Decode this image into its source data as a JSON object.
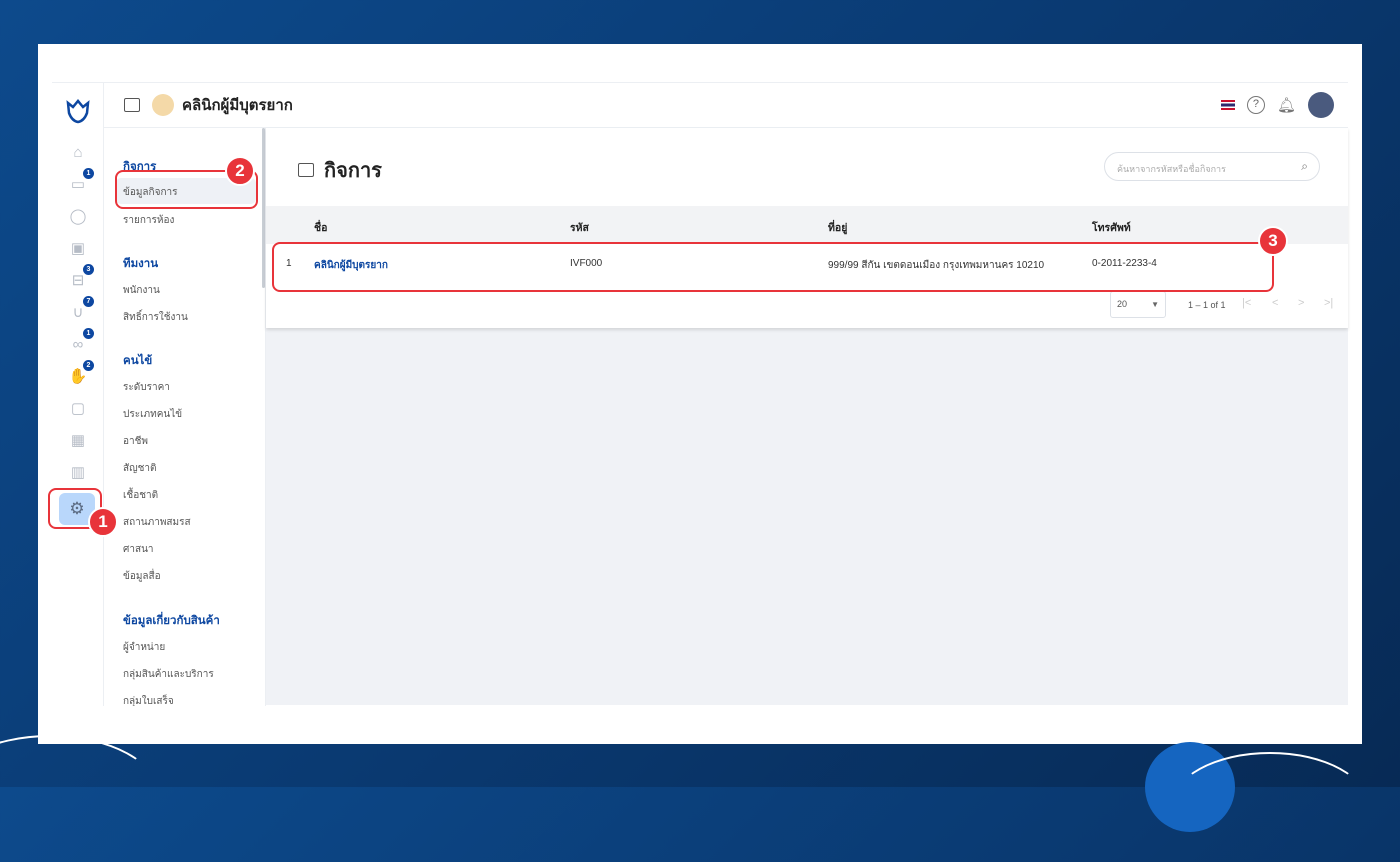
{
  "header": {
    "clinic_name": "คลินิกผู้มีบุตรยาก"
  },
  "rail": {
    "badges": {
      "appointments": "1",
      "treatment": "3",
      "doctor": "7",
      "lab": "1",
      "payment": "2"
    }
  },
  "menu": {
    "sections": [
      {
        "title": "กิจการ",
        "items": [
          "ข้อมูลกิจการ",
          "รายการห้อง"
        ]
      },
      {
        "title": "ทีมงาน",
        "items": [
          "พนักงาน",
          "สิทธิ์การใช้งาน"
        ]
      },
      {
        "title": "คนไข้",
        "items": [
          "ระดับราคา",
          "ประเภทคนไข้",
          "อาชีพ",
          "สัญชาติ",
          "เชื้อชาติ",
          "สถานภาพสมรส",
          "ศาสนา",
          "ข้อมูลสื่อ"
        ]
      },
      {
        "title": "ข้อมูลเกี่ยวกับสินค้า",
        "items": [
          "ผู้จำหน่าย",
          "กลุ่มสินค้าและบริการ",
          "กลุ่มใบเสร็จ"
        ]
      }
    ]
  },
  "page": {
    "title": "กิจการ",
    "search_placeholder": "ค้นหาจากรหัสหรือชื่อกิจการ"
  },
  "table": {
    "columns": [
      "ชื่อ",
      "รหัส",
      "ที่อยู่",
      "โทรศัพท์"
    ],
    "rows": [
      {
        "index": "1",
        "name": "คลินิกผู้มีบุตรยาก",
        "code": "IVF000",
        "address": "999/99 สีกัน เขตดอนเมือง กรุงเทพมหานคร 10210",
        "phone": "0-2011-2233-4"
      }
    ]
  },
  "pagination": {
    "page_size": "20",
    "range": "1 – 1 of 1"
  },
  "callouts": [
    "1",
    "2",
    "3"
  ],
  "colors": {
    "accent": "#0d47a1",
    "callout": "#e8343a"
  }
}
